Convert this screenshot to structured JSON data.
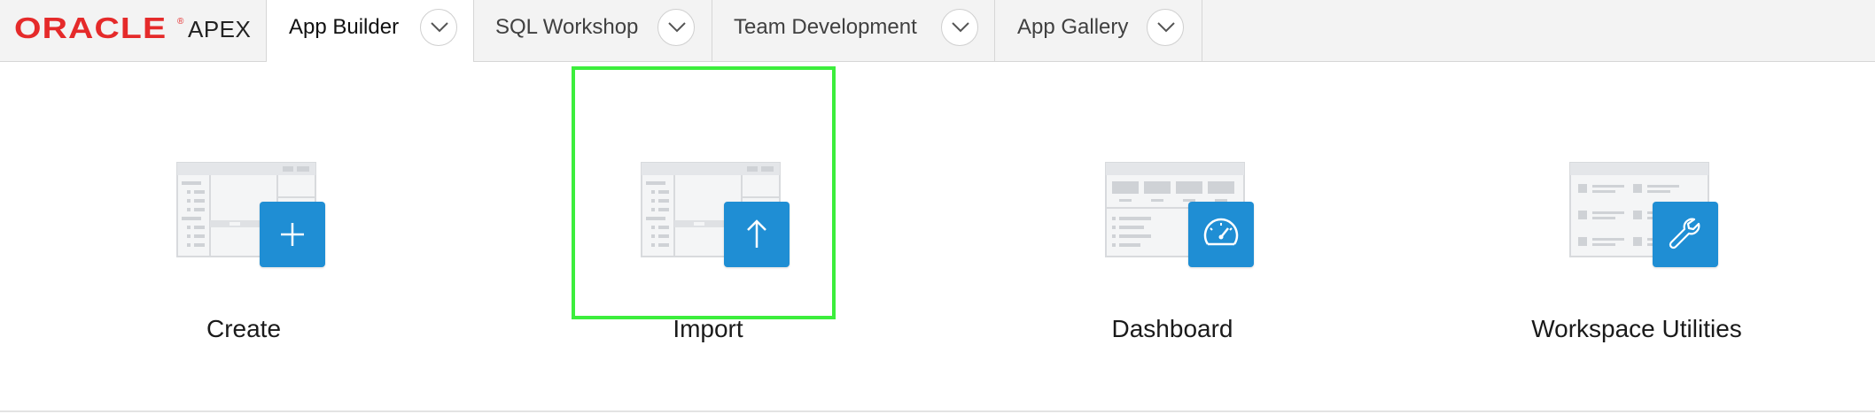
{
  "brand": {
    "oracle": "ORACLE",
    "reg": "®",
    "product": "APEX"
  },
  "nav": {
    "tabs": [
      {
        "label": "App Builder",
        "active": true
      },
      {
        "label": "SQL Workshop",
        "active": false
      },
      {
        "label": "Team Development",
        "active": false
      },
      {
        "label": "App Gallery",
        "active": false
      }
    ]
  },
  "tiles": [
    {
      "label": "Create",
      "icon": "plus-icon"
    },
    {
      "label": "Import",
      "icon": "upload-arrow-icon",
      "highlighted": true
    },
    {
      "label": "Dashboard",
      "icon": "speedometer-icon"
    },
    {
      "label": "Workspace Utilities",
      "icon": "wrench-icon"
    }
  ],
  "colors": {
    "accent_blue": "#1f8ed4",
    "oracle_red": "#e52a2a",
    "highlight_green": "#3cee3c"
  }
}
